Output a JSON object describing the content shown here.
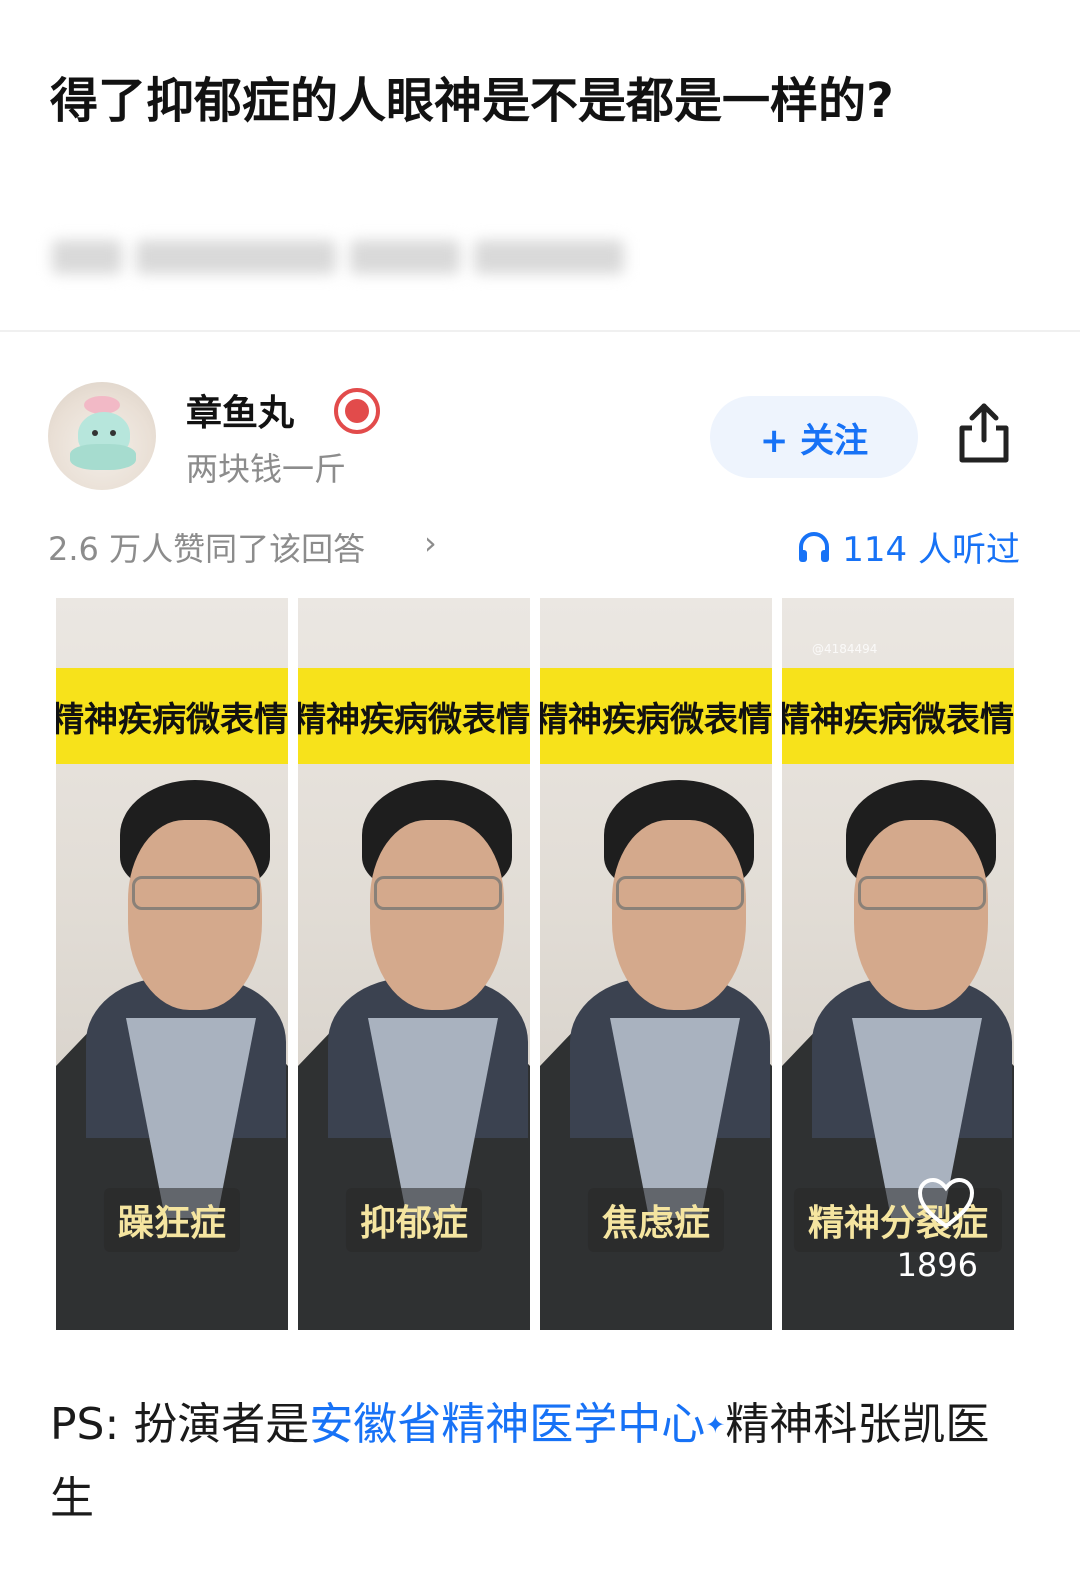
{
  "question": {
    "title": "得了抑郁症的人眼神是不是都是一样的?"
  },
  "author": {
    "name": "章鱼丸",
    "bio": "两块钱一斤",
    "follow_label": "+ 关注"
  },
  "stats": {
    "likes_text": "2.6 万人赞同了该回答",
    "likes_chevron": "›",
    "listen_text": "114 人听过"
  },
  "image": {
    "banner_text": "精神疾病微表情",
    "watermark": "@4184494",
    "like_count": "1896",
    "frames": [
      {
        "caption": "躁狂症"
      },
      {
        "caption": "抑郁症"
      },
      {
        "caption": "焦虑症"
      },
      {
        "caption": "精神分裂症"
      }
    ]
  },
  "ps": {
    "prefix": "PS: 扮演者是",
    "link": "安徽省精神医学中心",
    "sparkle": "✦",
    "suffix": "精神科张凯医生"
  },
  "colors": {
    "accent": "#1772f6",
    "banner_yellow": "#f7e21b",
    "badge_red": "#e24b4b"
  }
}
